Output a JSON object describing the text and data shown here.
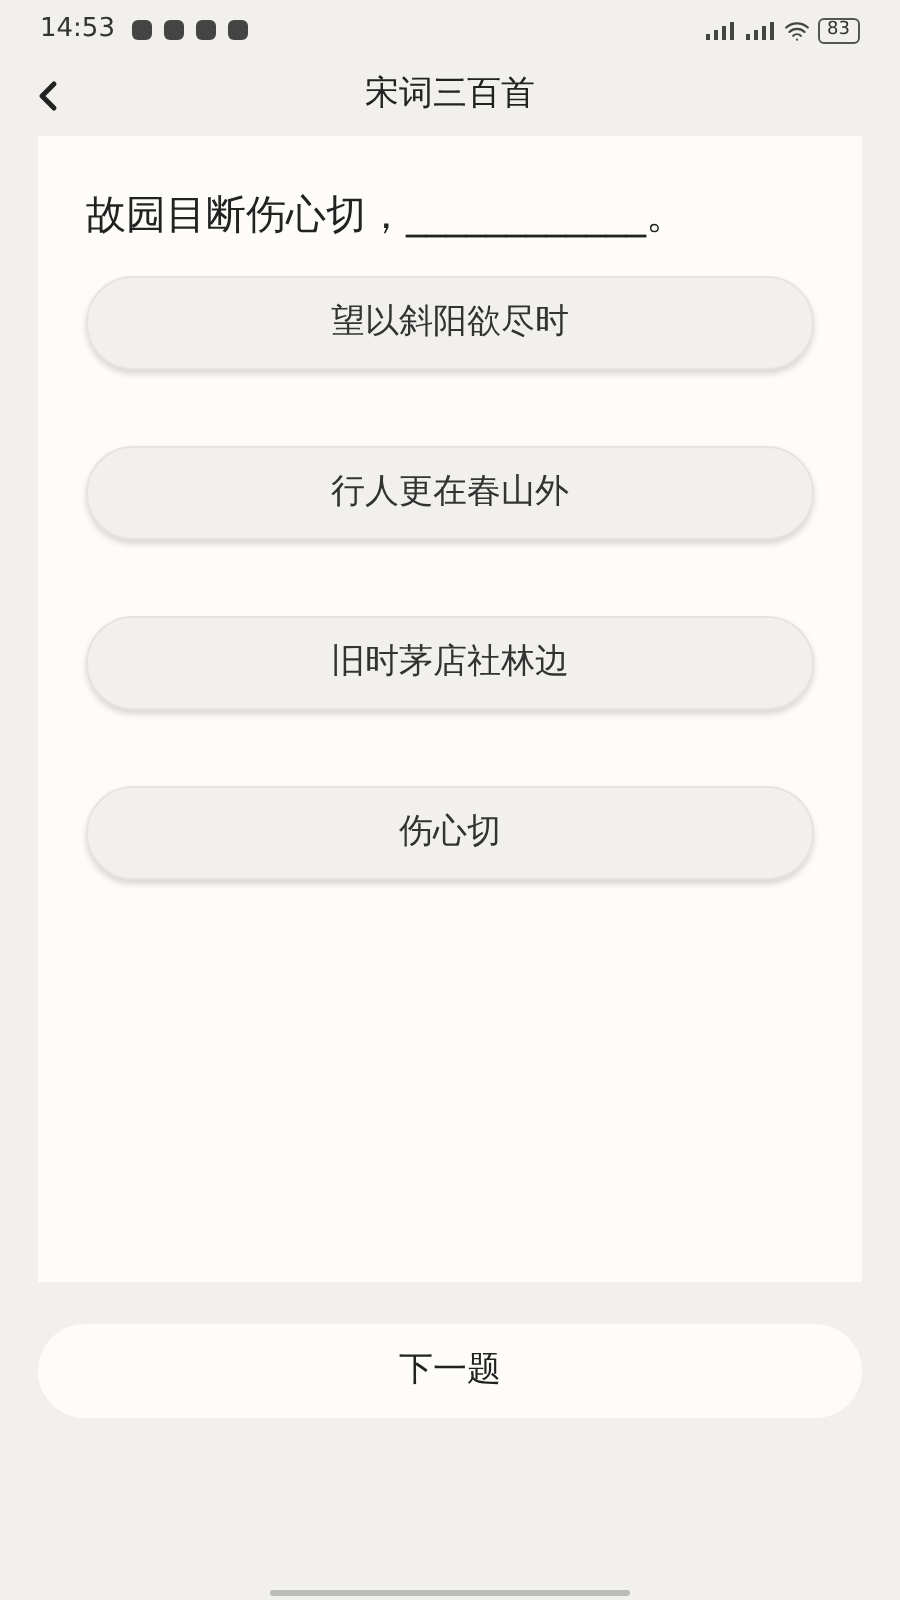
{
  "status_bar": {
    "time": "14:53",
    "battery": "83"
  },
  "header": {
    "title": "宋词三百首"
  },
  "question": "故园目断伤心切，____________。",
  "options": [
    {
      "label": "望以斜阳欲尽时"
    },
    {
      "label": "行人更在春山外"
    },
    {
      "label": "旧时茅店社林边"
    },
    {
      "label": "伤心切"
    }
  ],
  "next_button": "下一题"
}
